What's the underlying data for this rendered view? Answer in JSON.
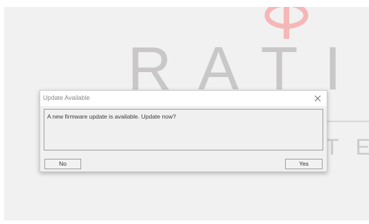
{
  "background": {
    "logo_letters_line1": "RATI",
    "logo_letters_line2": "TE",
    "logo_accent_color": "#f5b5b5",
    "logo_text_color": "#c9c7c7"
  },
  "dialog": {
    "title": "Update Available",
    "message": "A new firmware update is available. Update now?",
    "close_icon": "close-icon",
    "no_label": "No",
    "yes_label": "Yes"
  }
}
